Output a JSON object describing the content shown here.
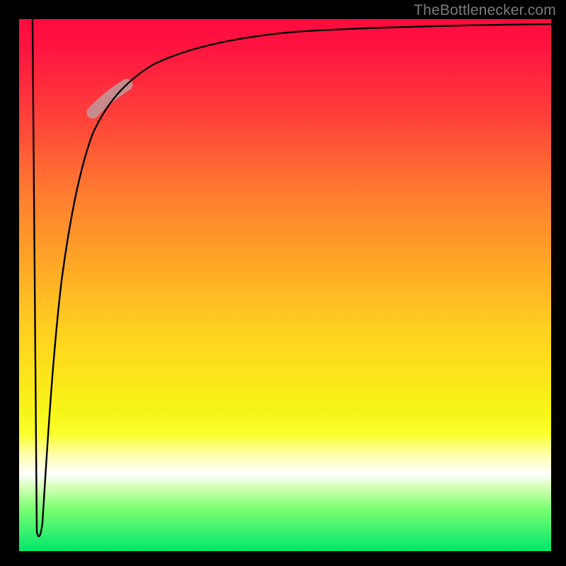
{
  "attribution": "TheBottlenecker.com",
  "colors": {
    "gradient_top": "#ff0b3e",
    "gradient_bottom": "#00e66b",
    "curve": "#000000",
    "highlight": "#c78a8d"
  },
  "chart_data": {
    "type": "line",
    "title": "",
    "xlabel": "",
    "ylabel": "",
    "xlim": [
      0,
      100
    ],
    "ylim": [
      0,
      100
    ],
    "series": [
      {
        "name": "main-curve",
        "points": [
          {
            "x": 2.5,
            "y": 100
          },
          {
            "x": 3.3,
            "y": 4
          },
          {
            "x": 4.5,
            "y": 30
          },
          {
            "x": 6,
            "y": 50
          },
          {
            "x": 8,
            "y": 65
          },
          {
            "x": 11,
            "y": 76
          },
          {
            "x": 15,
            "y": 83
          },
          {
            "x": 20,
            "y": 88
          },
          {
            "x": 28,
            "y": 92
          },
          {
            "x": 40,
            "y": 95
          },
          {
            "x": 55,
            "y": 96.5
          },
          {
            "x": 75,
            "y": 97.6
          },
          {
            "x": 100,
            "y": 98.2
          }
        ]
      }
    ],
    "highlight_segment": {
      "x_start": 14,
      "x_end": 20,
      "note": "thickened rose segment on the rising curve"
    }
  }
}
